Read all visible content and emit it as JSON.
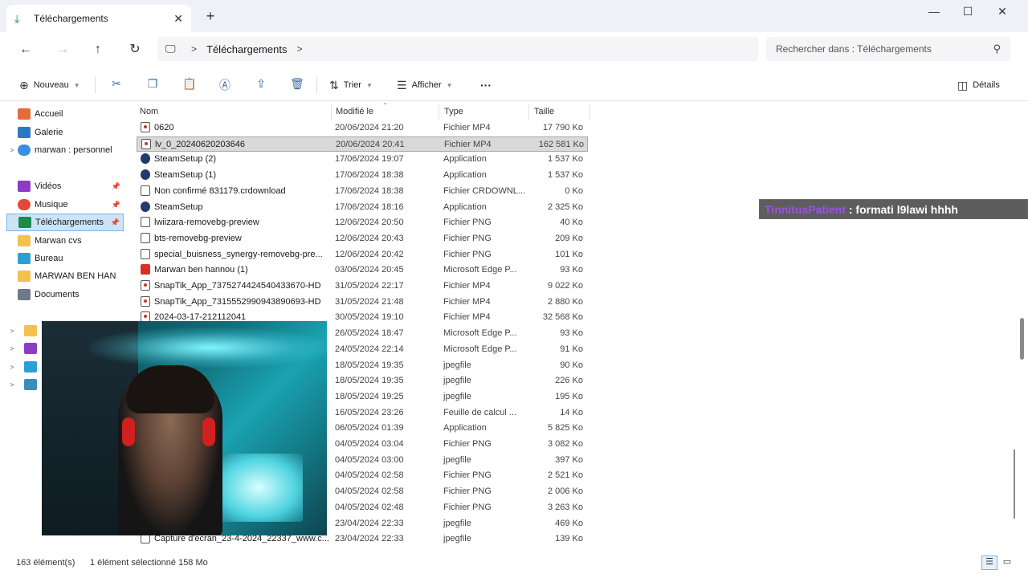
{
  "window": {
    "tab_title": "Téléchargements",
    "tab_close": "✕",
    "new_tab": "+",
    "minimize": "—",
    "maximize": "☐",
    "close": "✕"
  },
  "nav": {
    "back_icon": "←",
    "forward_icon": "→",
    "up_icon": "↑",
    "refresh_icon": "↻",
    "pc_icon": "🖵",
    "breadcrumb": "Téléchargements",
    "chevron": ">",
    "search_placeholder": "Rechercher dans : Téléchargements",
    "search_icon": "⚲"
  },
  "toolbar": {
    "new_label": "Nouveau",
    "sort_label": "Trier",
    "view_label": "Afficher",
    "more_label": "···",
    "details_label": "Détails"
  },
  "sidebar": {
    "items": [
      {
        "label": "Accueil",
        "icon": "home-icon",
        "color": "#e46b3a",
        "expand": "",
        "pin": ""
      },
      {
        "label": "Galerie",
        "icon": "gallery-icon",
        "color": "#2b79c2",
        "expand": "",
        "pin": ""
      },
      {
        "label": "marwan : personnel",
        "icon": "onedrive-icon",
        "color": "#3b8ee0",
        "expand": ">",
        "pin": ""
      },
      {
        "label": "Vidéos",
        "icon": "videos-icon",
        "color": "#8a3cc4",
        "expand": "",
        "pin": "📌"
      },
      {
        "label": "Musique",
        "icon": "music-icon",
        "color": "#e0493b",
        "expand": "",
        "pin": "📌"
      },
      {
        "label": "Téléchargements",
        "icon": "downloads-icon",
        "color": "#1a8c4a",
        "expand": "",
        "pin": "📌"
      },
      {
        "label": "Marwan cvs",
        "icon": "folder-icon",
        "color": "#f2c14e",
        "expand": "",
        "pin": ""
      },
      {
        "label": "Bureau",
        "icon": "desktop-icon",
        "color": "#2a9fd6",
        "expand": "",
        "pin": ""
      },
      {
        "label": "MARWAN BEN HAN",
        "icon": "folder-icon",
        "color": "#f2c14e",
        "expand": "",
        "pin": ""
      },
      {
        "label": "Documents",
        "icon": "documents-icon",
        "color": "#6c7a89",
        "expand": "",
        "pin": ""
      }
    ],
    "tree": [
      {
        "expand": ">",
        "color": "#f2c14e"
      },
      {
        "expand": ">",
        "color": "#8a3cc4"
      },
      {
        "expand": ">",
        "color": "#2a9fd6"
      },
      {
        "expand": ">",
        "color": "#3a8fb7"
      }
    ]
  },
  "columns": {
    "name": "Nom",
    "modified": "Modifié le",
    "type": "Type",
    "size": "Taille"
  },
  "files": [
    {
      "name": "0620",
      "date": "20/06/2024 21:20",
      "type": "Fichier MP4",
      "size": "17 790 Ko",
      "kind": "mp4"
    },
    {
      "name": "lv_0_20240620203646",
      "date": "20/06/2024 20:41",
      "type": "Fichier MP4",
      "size": "162 581 Ko",
      "kind": "mp4"
    },
    {
      "name": "SteamSetup (2)",
      "date": "17/06/2024 19:07",
      "type": "Application",
      "size": "1 537 Ko",
      "kind": "app"
    },
    {
      "name": "SteamSetup (1)",
      "date": "17/06/2024 18:38",
      "type": "Application",
      "size": "1 537 Ko",
      "kind": "app"
    },
    {
      "name": "Non confirmé 831179.crdownload",
      "date": "17/06/2024 18:38",
      "type": "Fichier CRDOWNL...",
      "size": "0 Ko",
      "kind": "file"
    },
    {
      "name": "SteamSetup",
      "date": "17/06/2024 18:16",
      "type": "Application",
      "size": "2 325 Ko",
      "kind": "app"
    },
    {
      "name": "lwiizara-removebg-preview",
      "date": "12/06/2024 20:50",
      "type": "Fichier PNG",
      "size": "40 Ko",
      "kind": "file"
    },
    {
      "name": "bts-removebg-preview",
      "date": "12/06/2024 20:43",
      "type": "Fichier PNG",
      "size": "209 Ko",
      "kind": "file"
    },
    {
      "name": "special_buisness_synergy-removebg-pre...",
      "date": "12/06/2024 20:42",
      "type": "Fichier PNG",
      "size": "101 Ko",
      "kind": "file"
    },
    {
      "name": "Marwan ben hannou (1)",
      "date": "03/06/2024 20:45",
      "type": "Microsoft Edge P...",
      "size": "93 Ko",
      "kind": "pdf"
    },
    {
      "name": "SnapTik_App_7375274424540433670-HD",
      "date": "31/05/2024 22:17",
      "type": "Fichier MP4",
      "size": "9 022 Ko",
      "kind": "mp4"
    },
    {
      "name": "SnapTik_App_7315552990943890693-HD",
      "date": "31/05/2024 21:48",
      "type": "Fichier MP4",
      "size": "2 880 Ko",
      "kind": "mp4"
    },
    {
      "name": "2024-03-17-212112041",
      "date": "30/05/2024 19:10",
      "type": "Fichier MP4",
      "size": "32 568 Ko",
      "kind": "mp4"
    },
    {
      "name": "",
      "date": "26/05/2024 18:47",
      "type": "Microsoft Edge P...",
      "size": "93 Ko",
      "kind": "none"
    },
    {
      "name": "",
      "date": "24/05/2024 22:14",
      "type": "Microsoft Edge P...",
      "size": "91 Ko",
      "kind": "none"
    },
    {
      "name": "",
      "date": "18/05/2024 19:35",
      "type": "jpegfile",
      "size": "90 Ko",
      "kind": "none"
    },
    {
      "name": "",
      "date": "18/05/2024 19:35",
      "type": "jpegfile",
      "size": "226 Ko",
      "kind": "none"
    },
    {
      "name": "",
      "date": "18/05/2024 19:25",
      "type": "jpegfile",
      "size": "195 Ko",
      "kind": "none"
    },
    {
      "name": "",
      "date": "16/05/2024 23:26",
      "type": "Feuille de calcul ...",
      "size": "14 Ko",
      "kind": "none"
    },
    {
      "name": "",
      "date": "06/05/2024 01:39",
      "type": "Application",
      "size": "5 825 Ko",
      "kind": "none"
    },
    {
      "name": "",
      "date": "04/05/2024 03:04",
      "type": "Fichier PNG",
      "size": "3 082 Ko",
      "kind": "none"
    },
    {
      "name": "",
      "date": "04/05/2024 03:00",
      "type": "jpegfile",
      "size": "397 Ko",
      "kind": "none"
    },
    {
      "name": "",
      "date": "04/05/2024 02:58",
      "type": "Fichier PNG",
      "size": "2 521 Ko",
      "kind": "none"
    },
    {
      "name": "",
      "date": "04/05/2024 02:58",
      "type": "Fichier PNG",
      "size": "2 006 Ko",
      "kind": "none"
    },
    {
      "name": "",
      "date": "04/05/2024 02:48",
      "type": "Fichier PNG",
      "size": "3 263 Ko",
      "kind": "none"
    },
    {
      "name": "",
      "date": "23/04/2024 22:33",
      "type": "jpegfile",
      "size": "469 Ko",
      "kind": "none"
    },
    {
      "name": "Capture d'écran_23-4-2024_22337_www.c...",
      "date": "23/04/2024 22:33",
      "type": "jpegfile",
      "size": "139 Ko",
      "kind": "file"
    }
  ],
  "status": {
    "count": "163 élément(s)",
    "selection": "1 élément sélectionné  158 Mo"
  },
  "chat": {
    "user": "TinnitusPatient",
    "message": ": formati l9lawi hhhh"
  },
  "colors": {
    "accent": "#0067c0",
    "selected_sidebar_bg": "#cce4f7",
    "selected_row_bg": "#d9d9d9"
  }
}
